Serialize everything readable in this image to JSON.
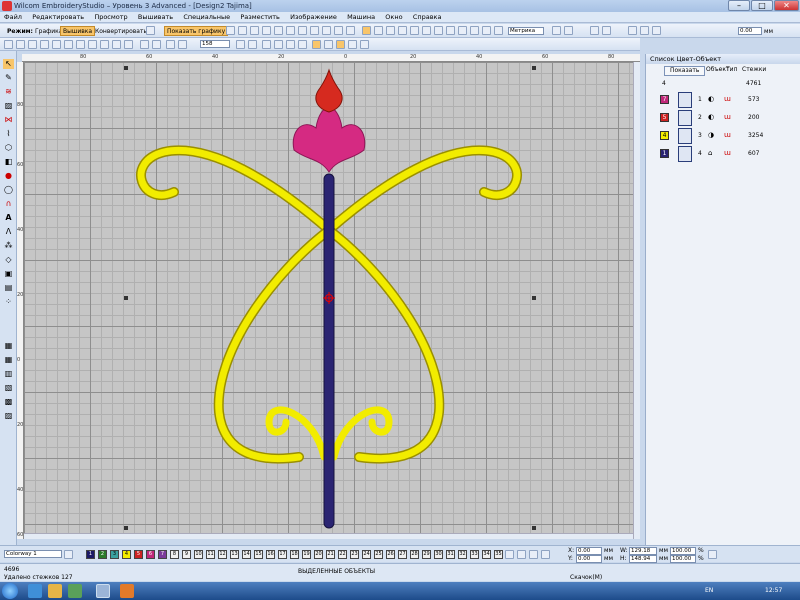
{
  "window": {
    "title": "Wilcom EmbroideryStudio – Уровень 3 Advanced - [Design2     Tajima]"
  },
  "menu": [
    "Файл",
    "Редактировать",
    "Просмотр",
    "Вышивать",
    "Специальные",
    "Разместить",
    "Изображение",
    "Машина",
    "Окно",
    "Справка"
  ],
  "toolbar": {
    "mode_label": "Режим:",
    "mode_graphics": "Графика",
    "mode_embroidery": "Вышивка",
    "convert": "Конвертировать",
    "show_graphics": "Показать графику",
    "units": "Метрика",
    "zoom_value": "158",
    "gap_value": "0.00",
    "gap_unit": "мм"
  },
  "ruler": {
    "h": [
      "80",
      "60",
      "40",
      "20",
      "0",
      "20",
      "40",
      "60",
      "80"
    ],
    "v": [
      "80",
      "60",
      "40",
      "20",
      "0",
      "20",
      "40",
      "60"
    ]
  },
  "panel": {
    "title": "Список Цвет-Объект",
    "show_button": "Показать",
    "col_objects": "Объект",
    "col_type": "Тип",
    "col_stitches": "Стежки",
    "total_objects": "4",
    "total_stitches": "4761",
    "rows": [
      {
        "tab": "7",
        "num": "1",
        "stitches": "573",
        "color": "#c0287a"
      },
      {
        "tab": "5",
        "num": "2",
        "stitches": "200",
        "color": "#cc2222"
      },
      {
        "tab": "4",
        "num": "3",
        "stitches": "3254",
        "color": "#f4ee00"
      },
      {
        "tab": "1",
        "num": "4",
        "stitches": "607",
        "color": "#2a2472"
      }
    ]
  },
  "colorway": "Colorway 1",
  "swatches": [
    "1",
    "2",
    "3",
    "4",
    "5",
    "6",
    "7",
    "8",
    "9",
    "10",
    "11",
    "12",
    "13",
    "14",
    "15",
    "16",
    "17",
    "18",
    "19",
    "20",
    "21",
    "22",
    "23",
    "24",
    "25",
    "26",
    "27",
    "28",
    "29",
    "30",
    "31",
    "32",
    "33",
    "34",
    "35"
  ],
  "swatch_colors": [
    "#1c1a66",
    "#2a7a2a",
    "#3aa0a0",
    "#f4ee00",
    "#cc2222",
    "#c0287a",
    "#7a3a9a",
    "#f0f0f0",
    "#f0f0f0",
    "#f0f0f0",
    "#f0f0f0",
    "#f0f0f0",
    "#f0f0f0",
    "#f0f0f0",
    "#f0f0f0",
    "#f0f0f0",
    "#f0f0f0",
    "#f0f0f0",
    "#f0f0f0",
    "#f0f0f0",
    "#f0f0f0",
    "#f0f0f0",
    "#f0f0f0",
    "#f0f0f0",
    "#f0f0f0",
    "#f0f0f0",
    "#f0f0f0",
    "#f0f0f0",
    "#f0f0f0",
    "#f0f0f0",
    "#f0f0f0",
    "#f0f0f0",
    "#f0f0f0",
    "#f0f0f0",
    "#f0f0f0"
  ],
  "coords": {
    "x_label": "X:",
    "x": "0.00",
    "y_label": "Y:",
    "y": "0.00",
    "w_label": "W:",
    "w": "129.18",
    "h_label": "H:",
    "h": "148.94",
    "unit": "мм",
    "sx": "100.00",
    "sy": "100.00",
    "pct": "%"
  },
  "status": {
    "stitch_count": "4696",
    "deleted": "Удалено стежков 127",
    "selected": "ВЫДЕЛЕННЫЕ ОБЪЕКТЫ",
    "jumps": "Скачок(M)"
  },
  "taskbar": {
    "lang": "EN",
    "clock": "12:57"
  }
}
